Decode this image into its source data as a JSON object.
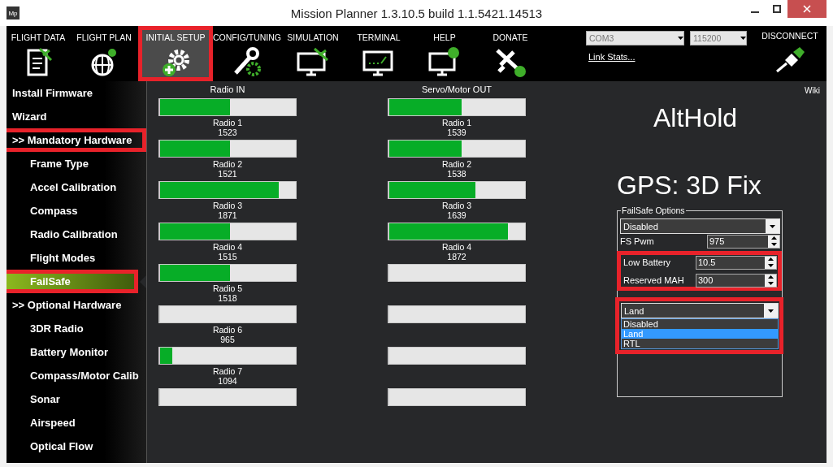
{
  "window": {
    "title": "Mission Planner 1.3.10.5 build 1.1.5421.14513",
    "logo": "Mp"
  },
  "toolbar": {
    "items": [
      {
        "label": "FLIGHT DATA",
        "kind": "data",
        "selected": false,
        "highlighted": false
      },
      {
        "label": "FLIGHT PLAN",
        "kind": "plan",
        "selected": false,
        "highlighted": false
      },
      {
        "label": "INITIAL SETUP",
        "kind": "setup",
        "selected": true,
        "highlighted": true
      },
      {
        "label": "CONFIG/TUNING",
        "kind": "tuning",
        "selected": false,
        "highlighted": false
      },
      {
        "label": "SIMULATION",
        "kind": "simulation",
        "selected": false,
        "highlighted": false
      },
      {
        "label": "TERMINAL",
        "kind": "terminal",
        "selected": false,
        "highlighted": false
      },
      {
        "label": "HELP",
        "kind": "help",
        "selected": false,
        "highlighted": false
      },
      {
        "label": "DONATE",
        "kind": "donate",
        "selected": false,
        "highlighted": false
      }
    ]
  },
  "connection": {
    "port": "COM3",
    "baud": "115200",
    "link": "Link Stats...",
    "button": "DISCONNECT"
  },
  "sidebar": {
    "items": [
      {
        "label": "Install Firmware",
        "selected": false,
        "highlighted": false
      },
      {
        "label": "Wizard",
        "selected": false,
        "highlighted": false
      },
      {
        "label": ">> Mandatory Hardware",
        "selected": false,
        "highlighted": true,
        "children": [
          {
            "label": "Frame Type",
            "selected": false,
            "highlighted": false
          },
          {
            "label": "Accel Calibration",
            "selected": false,
            "highlighted": false
          },
          {
            "label": "Compass",
            "selected": false,
            "highlighted": false
          },
          {
            "label": "Radio Calibration",
            "selected": false,
            "highlighted": false
          },
          {
            "label": "Flight Modes",
            "selected": false,
            "highlighted": false
          },
          {
            "label": "FailSafe",
            "selected": true,
            "highlighted": true
          }
        ]
      },
      {
        "label": ">> Optional Hardware",
        "selected": false,
        "highlighted": false,
        "children": [
          {
            "label": "3DR Radio",
            "selected": false,
            "highlighted": false
          },
          {
            "label": "Battery Monitor",
            "selected": false,
            "highlighted": false
          },
          {
            "label": "Compass/Motor Calib",
            "selected": false,
            "highlighted": false
          },
          {
            "label": "Sonar",
            "selected": false,
            "highlighted": false
          },
          {
            "label": "Airspeed",
            "selected": false,
            "highlighted": false
          },
          {
            "label": "Optical Flow",
            "selected": false,
            "highlighted": false
          }
        ]
      }
    ]
  },
  "radio_in": {
    "title": "Radio IN",
    "channels": [
      {
        "name": "Radio 1",
        "reading": "1523",
        "level": 0.51
      },
      {
        "name": "Radio 2",
        "reading": "1521",
        "level": 0.51
      },
      {
        "name": "Radio 3",
        "reading": "1871",
        "level": 0.87
      },
      {
        "name": "Radio 4",
        "reading": "1515",
        "level": 0.51
      },
      {
        "name": "Radio 5",
        "reading": "1518",
        "level": 0.51
      },
      {
        "name": "Radio 6",
        "reading": "965",
        "level": 0
      },
      {
        "name": "Radio 7",
        "reading": "1094",
        "level": 0.09
      },
      {
        "level": 0
      }
    ]
  },
  "servo_out": {
    "title": "Servo/Motor OUT",
    "channels": [
      {
        "name": "Radio 1",
        "reading": "1539",
        "level": 0.53
      },
      {
        "name": "Radio 2",
        "reading": "1538",
        "level": 0.53
      },
      {
        "name": "Radio 3",
        "reading": "1639",
        "level": 0.63
      },
      {
        "name": "Radio 4",
        "reading": "1872",
        "level": 0.87
      },
      {
        "level": 0
      },
      {
        "level": 0
      },
      {
        "level": 0
      },
      {
        "level": 0
      }
    ]
  },
  "wiki": "Wiki",
  "mode": "AltHold",
  "gps": "GPS: 3D Fix",
  "failsafe": {
    "title": "FailSafe Options",
    "mode": "Disabled",
    "fs_pwm": {
      "label": "FS Pwm",
      "value": "975"
    },
    "battery": {
      "highlighted": true,
      "fields": [
        {
          "label": "Low Battery",
          "value": "10.5"
        },
        {
          "label": "Reserved MAH",
          "value": "300"
        }
      ]
    },
    "action": {
      "highlighted": true,
      "value": "Land",
      "expanded": true,
      "options": [
        {
          "label": "Disabled",
          "selected": false
        },
        {
          "label": "Land",
          "selected": true
        },
        {
          "label": "RTL",
          "selected": false
        }
      ]
    }
  }
}
